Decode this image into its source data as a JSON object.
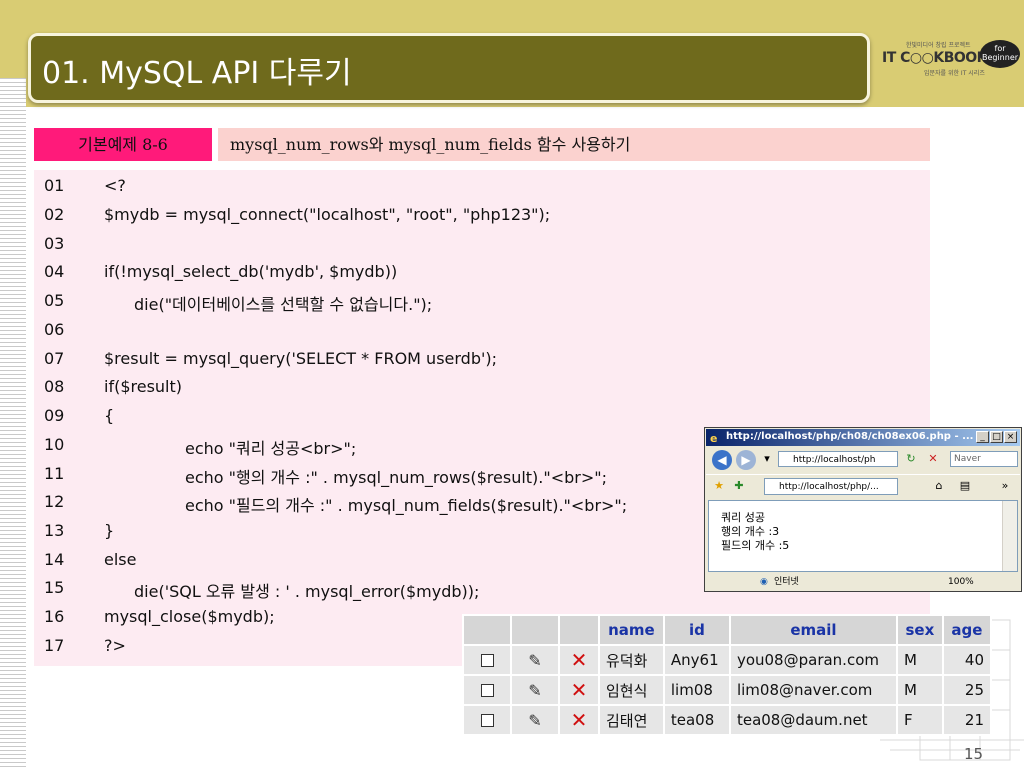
{
  "slide": {
    "title": "01.  MySQL API  다루기",
    "page_number": "15",
    "logo": {
      "main": "IT C○○KBOOK",
      "sub_top": "한빛미디어 창립 프로젝트",
      "sub_bottom": "입문자를 위한 IT 시리즈",
      "badge": "for Beginner"
    }
  },
  "example": {
    "tag": "기본예제 8-6",
    "title": "mysql_num_rows와 mysql_num_fields 함수 사용하기"
  },
  "code_lines": [
    {
      "num": "01",
      "text": "<?"
    },
    {
      "num": "02",
      "text": "$mydb = mysql_connect(\"localhost\", \"root\", \"php123\");"
    },
    {
      "num": "03",
      "text": ""
    },
    {
      "num": "04",
      "text": "if(!mysql_select_db('mydb', $mydb))"
    },
    {
      "num": "05",
      "text": "die(\"데이터베이스를 선택할 수 없습니다.\");"
    },
    {
      "num": "06",
      "text": ""
    },
    {
      "num": "07",
      "text": "$result = mysql_query('SELECT * FROM userdb');"
    },
    {
      "num": "08",
      "text": "if($result)"
    },
    {
      "num": "09",
      "text": "{"
    },
    {
      "num": "10",
      "text": "echo \"쿼리 성공<br>\";"
    },
    {
      "num": "11",
      "text": "echo \"행의 개수 :\" . mysql_num_rows($result).\"<br>\";"
    },
    {
      "num": "12",
      "text": "echo \"필드의 개수 :\" . mysql_num_fields($result).\"<br>\";"
    },
    {
      "num": "13",
      "text": "}"
    },
    {
      "num": "14",
      "text": "else"
    },
    {
      "num": "15",
      "text": "die('SQL 오류 발생 : ' . mysql_error($mydb));"
    },
    {
      "num": "16",
      "text": "mysql_close($mydb);"
    },
    {
      "num": "17",
      "text": "?>"
    }
  ],
  "browser": {
    "window_title": "http://localhost/php/ch08/ch08ex06.php - ...",
    "address": "http://localhost/ph",
    "search_placeholder": "Naver",
    "tab_label": "http://localhost/php/...",
    "output_lines": [
      "쿼리 성공",
      "행의 개수 :3",
      "필드의 개수 :5"
    ],
    "status_zone": "인터넷",
    "status_zoom": "100%"
  },
  "db_table": {
    "columns": [
      "name",
      "id",
      "email",
      "sex",
      "age"
    ],
    "rows": [
      [
        "유덕화",
        "Any61",
        "you08@paran.com",
        "M",
        "40"
      ],
      [
        "임현식",
        "lim08",
        "lim08@naver.com",
        "M",
        "25"
      ],
      [
        "김태연",
        "tea08",
        "tea08@daum.net",
        "F",
        "21"
      ]
    ]
  }
}
